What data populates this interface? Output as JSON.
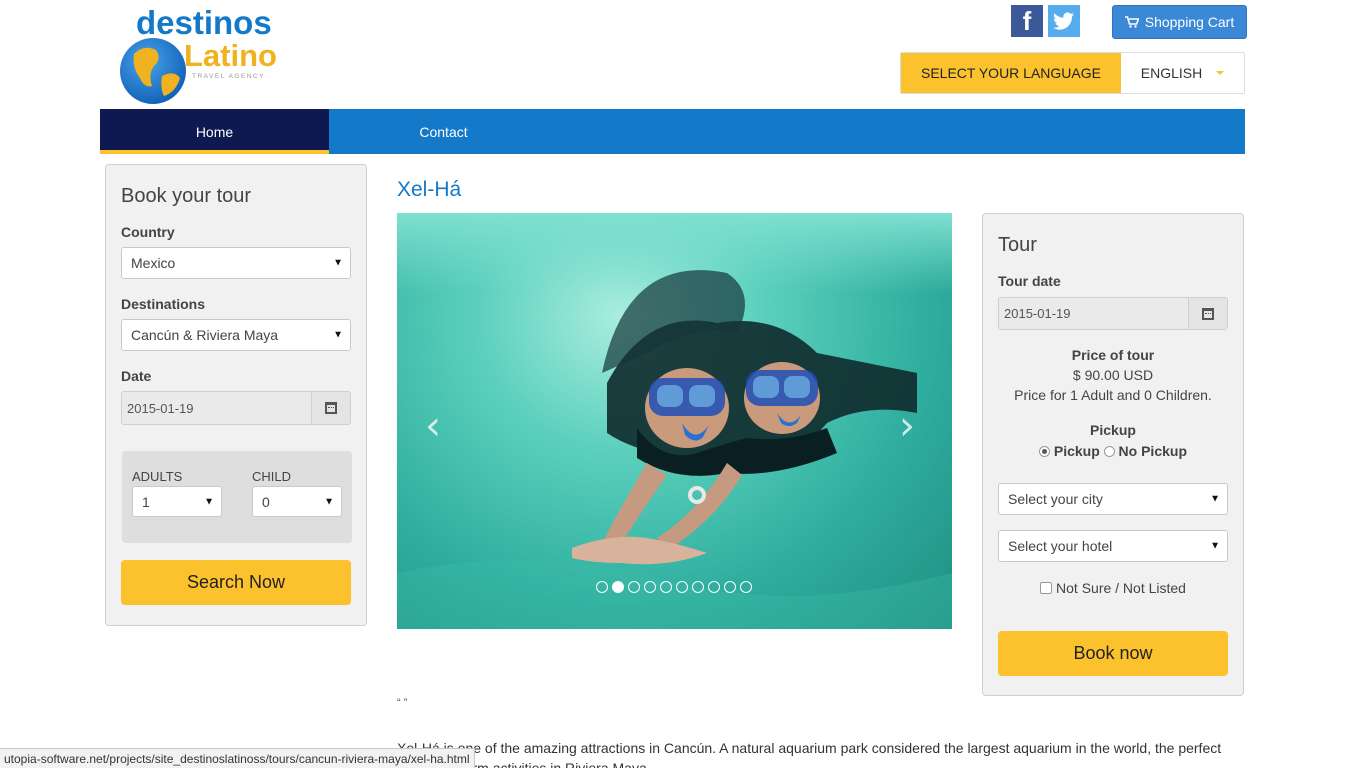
{
  "header": {
    "logo_line1": "destinos",
    "logo_line2": "Latinos",
    "logo_tagline": "TRAVEL AGENCY",
    "cart_label": "Shopping Cart",
    "language_label": "SELECT YOUR LANGUAGE",
    "language_value": "ENGLISH"
  },
  "nav": {
    "items": [
      {
        "label": "Home"
      },
      {
        "label": "Contact"
      }
    ]
  },
  "search": {
    "title": "Book your tour",
    "country_label": "Country",
    "country_value": "Mexico",
    "destinations_label": "Destinations",
    "destinations_value": "Cancún & Riviera Maya",
    "date_label": "Date",
    "date_value": "2015-01-19",
    "adults_label": "ADULTS",
    "adults_value": "1",
    "child_label": "CHILD",
    "child_value": "0",
    "search_button": "Search Now"
  },
  "tour": {
    "name": "Xel-Há",
    "quote": "“ ”",
    "description": "Xel-Há is one of the amazing attractions in Cancún. A natural aquarium park considered the largest aquarium in the world, the perfect place for warm activities in Riviera Maya.",
    "carousel_slides": 10,
    "carousel_active": 2
  },
  "booking": {
    "title": "Tour",
    "date_label": "Tour date",
    "date_value": "2015-01-19",
    "price_label": "Price of tour",
    "price_value": "$ 90.00 USD",
    "price_note": "Price for 1 Adult and 0 Children.",
    "pickup_label": "Pickup",
    "pickup_option": "Pickup",
    "no_pickup_option": "No Pickup",
    "city_placeholder": "Select your city",
    "hotel_placeholder": "Select your hotel",
    "not_sure_label": "Not Sure / Not Listed",
    "book_button": "Book now"
  },
  "statusbar": {
    "url": "utopia-software.net/projects/site_destinoslatinoss/tours/cancun-riviera-maya/xel-ha.html"
  },
  "colors": {
    "brand_blue": "#1479c8",
    "nav_active": "#0d1950",
    "accent_yellow": "#fbc22e"
  }
}
